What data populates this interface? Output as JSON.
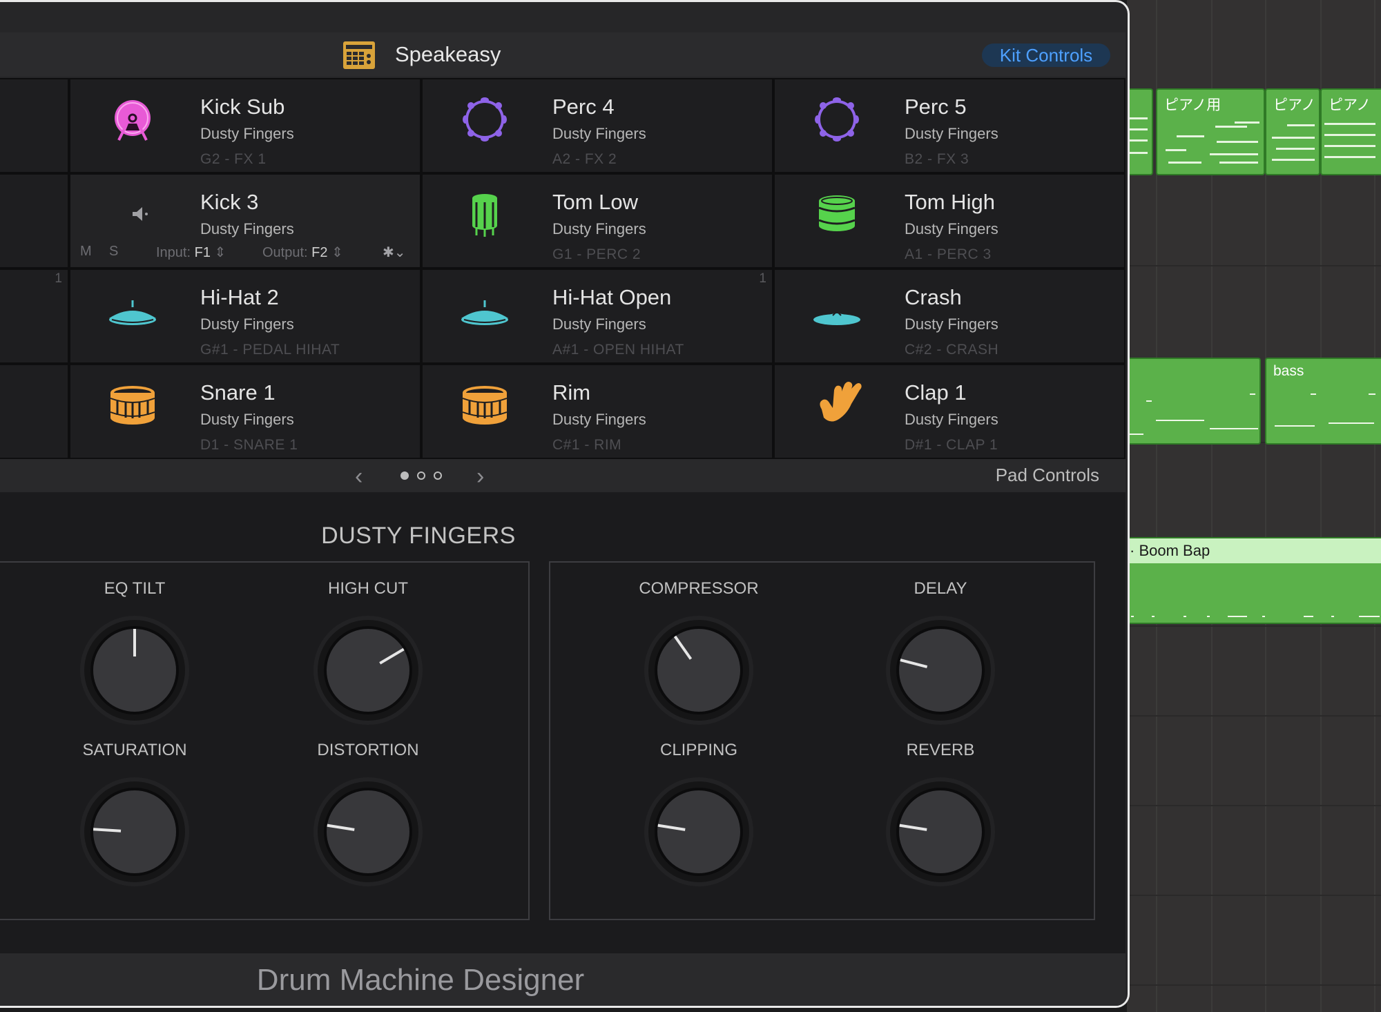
{
  "window": {
    "kit_name": "Speakeasy",
    "kit_controls_label": "Kit Controls"
  },
  "pads": [
    {
      "name": "Kick Sub",
      "sub": "Dusty Fingers",
      "note": "G2 - FX 1",
      "icon": "kick-drum-icon",
      "color": "#e85ad6"
    },
    {
      "name": "Perc 4",
      "sub": "Dusty Fingers",
      "note": "A2 - FX 2",
      "icon": "tambourine-icon",
      "color": "#8e63e8"
    },
    {
      "name": "Perc 5",
      "sub": "Dusty Fingers",
      "note": "B2 - FX 3",
      "icon": "tambourine-icon",
      "color": "#8e63e8"
    },
    {
      "name": "Kick 3",
      "sub": "Dusty Fingers",
      "note": "",
      "icon": "speaker-icon",
      "color": "#9a9a9e",
      "selected": true,
      "controls": {
        "mute": "M",
        "solo": "S",
        "input_label": "Input:",
        "input_value": "F1",
        "output_label": "Output:",
        "output_value": "F2"
      }
    },
    {
      "name": "Tom Low",
      "sub": "Dusty Fingers",
      "note": "G1 - PERC 2",
      "icon": "tom-drum-icon",
      "color": "#56d24c"
    },
    {
      "name": "Tom High",
      "sub": "Dusty Fingers",
      "note": "A1 - PERC 3",
      "icon": "tom-drum-icon",
      "color": "#56d24c"
    },
    {
      "name": "Hi-Hat 2",
      "sub": "Dusty Fingers",
      "note": "G#1 - PEDAL HIHAT",
      "icon": "hihat-icon",
      "color": "#4fc6cf"
    },
    {
      "name": "Hi-Hat Open",
      "sub": "Dusty Fingers",
      "note": "A#1 - OPEN HIHAT",
      "icon": "hihat-icon",
      "color": "#4fc6cf",
      "badge": "1"
    },
    {
      "name": "Crash",
      "sub": "Dusty Fingers",
      "note": "C#2 - CRASH",
      "icon": "cymbal-icon",
      "color": "#4fc6cf"
    },
    {
      "name": "Snare 1",
      "sub": "Dusty Fingers",
      "note": "D1 - SNARE 1",
      "icon": "snare-drum-icon",
      "color": "#f0a13a"
    },
    {
      "name": "Rim",
      "sub": "Dusty Fingers",
      "note": "C#1 - RIM",
      "icon": "snare-drum-icon",
      "color": "#f0a13a"
    },
    {
      "name": "Clap 1",
      "sub": "Dusty Fingers",
      "note": "D#1 - CLAP 1",
      "icon": "clap-hand-icon",
      "color": "#f0a13a"
    }
  ],
  "left_column_badge": "1",
  "pager": {
    "pages": 3,
    "current": 1,
    "pad_controls_label": "Pad Controls"
  },
  "section": {
    "title": "DUSTY FINGERS"
  },
  "knobs": [
    {
      "label": "EQ TILT",
      "value": 0.5
    },
    {
      "label": "HIGH CUT",
      "value": 0.72
    },
    {
      "label": "COMPRESSOR",
      "value": 0.37
    },
    {
      "label": "DELAY",
      "value": 0.22
    },
    {
      "label": "SATURATION",
      "value": 0.18
    },
    {
      "label": "DISTORTION",
      "value": 0.2
    },
    {
      "label": "CLIPPING",
      "value": 0.2
    },
    {
      "label": "REVERB",
      "value": 0.2
    }
  ],
  "footer": {
    "title": "Drum Machine Designer"
  },
  "timeline": {
    "region_labels": [
      "ピアノ用",
      "ピアノ",
      "ピアノ",
      "bass",
      "Boom Bap"
    ]
  }
}
